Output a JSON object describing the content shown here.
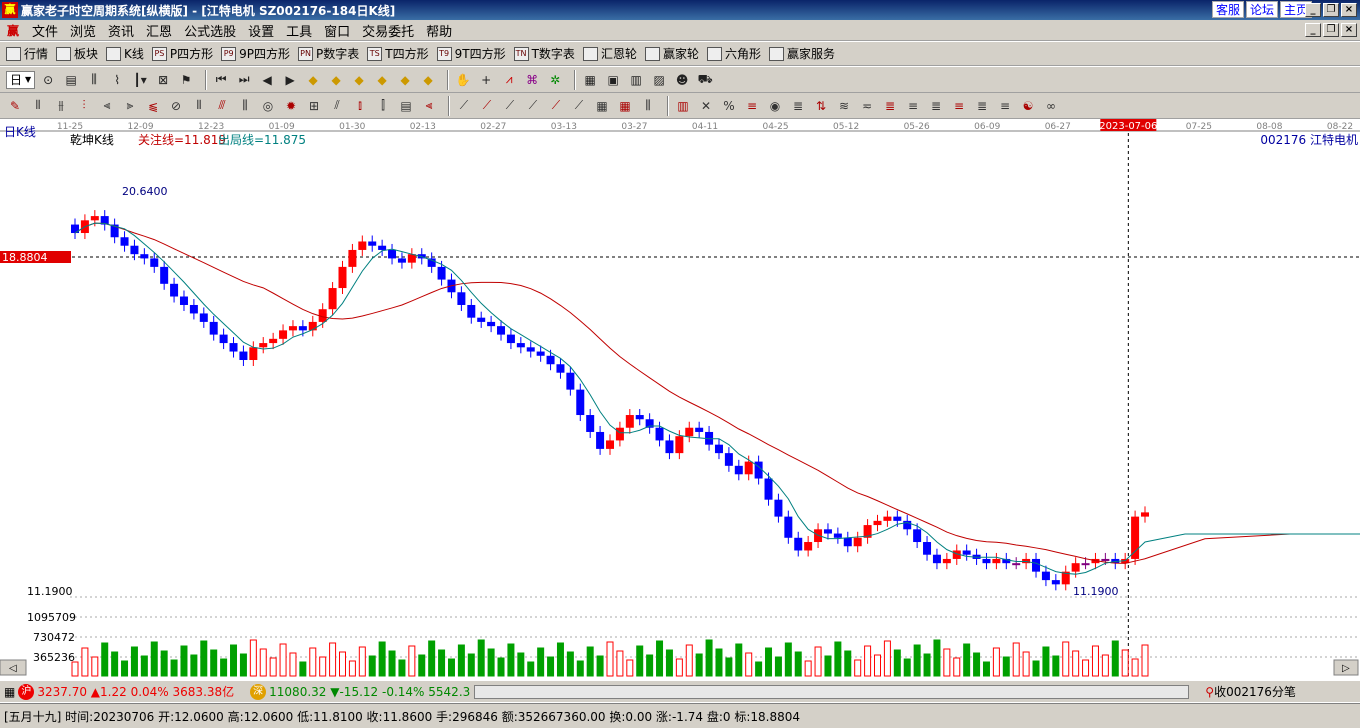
{
  "app_title": "赢家老子时空周期系统[纵横版] - [江特电机   SZ002176-184日K线]",
  "title_links": [
    "客服",
    "论坛",
    "主页"
  ],
  "menu": [
    "文件",
    "浏览",
    "资讯",
    "汇恩",
    "公式选股",
    "设置",
    "工具",
    "窗口",
    "交易委托",
    "帮助"
  ],
  "toolbar1": [
    {
      "label": "行情",
      "icon": "grid-icon"
    },
    {
      "label": "板块",
      "icon": "blocks-icon"
    },
    {
      "label": "K线",
      "icon": "candle-icon"
    },
    {
      "label": "P四方形",
      "icon": "PS"
    },
    {
      "label": "9P四方形",
      "icon": "P9"
    },
    {
      "label": "P数字表",
      "icon": "PN"
    },
    {
      "label": "T四方形",
      "icon": "TS"
    },
    {
      "label": "9T四方形",
      "icon": "T9"
    },
    {
      "label": "T数字表",
      "icon": "TN"
    },
    {
      "label": "汇恩轮",
      "icon": "wheel-icon"
    },
    {
      "label": "赢家轮",
      "icon": "wheel-icon"
    },
    {
      "label": "六角形",
      "icon": "hexagon-icon"
    },
    {
      "label": "赢家服务",
      "icon": "dollar-icon"
    }
  ],
  "period_label": "日",
  "chart": {
    "period_label": "日K线",
    "indicator_name": "乾坤K线",
    "focus_line_label": "关注线=11.819",
    "exit_line_label": "出局线=11.875",
    "stock_code_name": "002176  江特电机",
    "cursor_date": "2023-07-06",
    "cursor_price": "18.8804",
    "high_label": "20.6400",
    "low_label": "11.1900",
    "axis_price_label": "11.1900",
    "vol_ticks": [
      "1095709",
      "730472",
      "365236"
    ],
    "dates": [
      "11-25",
      "12-09",
      "12-23",
      "01-09",
      "01-30",
      "02-13",
      "02-27",
      "03-13",
      "03-27",
      "04-11",
      "04-25",
      "05-12",
      "05-26",
      "06-09",
      "06-27",
      "2023-07-06",
      "07-25",
      "08-08",
      "08-22"
    ],
    "colors": {
      "up": "#ff0000",
      "down": "#0000ff",
      "neutral": "#800080",
      "ma_slow": "#c00000",
      "ma_fast": "#008080",
      "vol_up": "#ff0000",
      "vol_down": "#00a000"
    }
  },
  "chart_data": {
    "type": "candlestick",
    "closes": [
      19.6,
      19.9,
      20.0,
      19.8,
      19.5,
      19.3,
      19.1,
      19.0,
      18.8,
      18.4,
      18.1,
      17.9,
      17.7,
      17.5,
      17.2,
      17.0,
      16.8,
      16.6,
      16.9,
      17.0,
      17.1,
      17.3,
      17.4,
      17.3,
      17.5,
      17.8,
      18.3,
      18.8,
      19.2,
      19.4,
      19.3,
      19.2,
      19.0,
      18.9,
      19.1,
      19.0,
      18.8,
      18.5,
      18.2,
      17.9,
      17.6,
      17.5,
      17.4,
      17.2,
      17.0,
      16.9,
      16.8,
      16.7,
      16.5,
      16.3,
      15.9,
      15.3,
      14.9,
      14.5,
      14.7,
      15.0,
      15.3,
      15.2,
      15.0,
      14.7,
      14.4,
      14.8,
      15.0,
      14.9,
      14.6,
      14.4,
      14.1,
      13.9,
      14.2,
      13.8,
      13.3,
      12.9,
      12.4,
      12.1,
      12.3,
      12.6,
      12.5,
      12.4,
      12.2,
      12.4,
      12.7,
      12.8,
      12.9,
      12.8,
      12.6,
      12.3,
      12.0,
      11.8,
      11.9,
      12.1,
      12.0,
      11.9,
      11.8,
      11.9,
      11.8,
      11.8,
      11.9,
      11.6,
      11.4,
      11.3,
      11.6,
      11.8,
      11.8,
      11.9,
      11.9,
      11.8,
      11.9,
      12.9,
      13.0
    ],
    "ylim": [
      11.19,
      20.64
    ]
  },
  "status": {
    "sh_badge": "沪",
    "sh_value": "3237.70",
    "sh_change": "▲1.22",
    "sh_pct": "0.04%",
    "sh_amount": "3683.38亿",
    "sz_badge": "深",
    "sz_value": "11080.32",
    "sz_change": "▼-15.12",
    "sz_pct": "-0.14%",
    "sz_amount": "5542.3",
    "ticks_label": "收002176分笔"
  },
  "info": {
    "text": "[五月十九] 时间:20230706  开:12.0600  高:12.0600  低:11.8100  收:11.8600  手:296846  额:352667360.00  换:0.00  涨:-1.74  盘:0  标:18.8804"
  }
}
